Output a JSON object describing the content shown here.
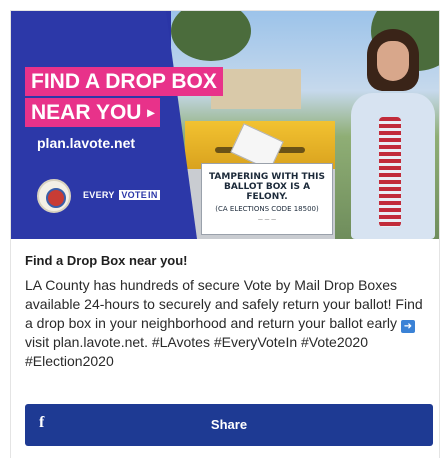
{
  "hero": {
    "headline_line1": "FIND A DROP BOX",
    "headline_line2": "NEAR YOU",
    "headline_arrow_icon": "chevron-right-icon",
    "url": "plan.lavote.net",
    "brand_every": "EVERY",
    "brand_vote": "VOTE",
    "brand_in": "IN",
    "sign_line1": "TAMPERING WITH THIS",
    "sign_line2": "BALLOT BOX IS A FELONY.",
    "sign_line3": "(CA ELECTIONS CODE 18500)",
    "accent_color": "#e8328a",
    "brand_color": "#2c38a8"
  },
  "post": {
    "title": "Find a Drop Box near you!",
    "body_before_icon": "LA County has hundreds of secure Vote by Mail Drop Boxes available 24-hours to securely and safely return your ballot! Find a drop box in your neighborhood and return your ballot early ",
    "inline_icon": "right-arrow-emoji-icon",
    "body_after_icon": " visit plan.lavote.net. #LAvotes #EveryVoteIn #Vote2020 #Election2020"
  },
  "share_button": {
    "icon": "facebook-icon",
    "label": "Share",
    "color": "#1e3a93"
  }
}
